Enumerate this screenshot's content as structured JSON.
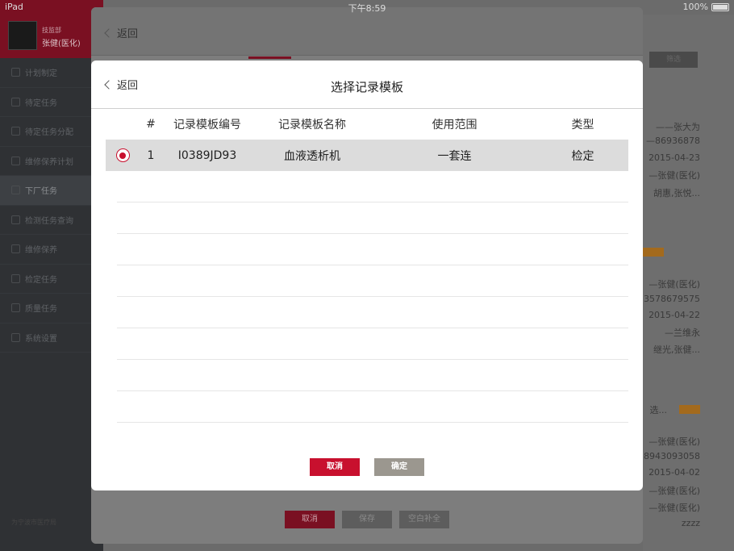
{
  "statusbar": {
    "device": "iPad",
    "time": "下午8:59",
    "battery": "100%"
  },
  "sidebar": {
    "role": "技监部",
    "name": "张健(医化)",
    "items": [
      {
        "label": "计划制定"
      },
      {
        "label": "待定任务"
      },
      {
        "label": "待定任务分配"
      },
      {
        "label": "维修保养计划"
      },
      {
        "label": "下厂任务",
        "active": true
      },
      {
        "label": "检测任务查询"
      },
      {
        "label": "维修保养"
      },
      {
        "label": "检定任务"
      },
      {
        "label": "质量任务"
      },
      {
        "label": "系统设置"
      }
    ],
    "footer": "为宁波市医疗局"
  },
  "background": {
    "top_button": "筛选",
    "lines": [
      "——张大为",
      "—86936878",
      "2015-04-23",
      "—张健(医化)",
      "胡惠,张悦...",
      "—张健(医化)",
      "13578679575",
      "2015-04-22",
      "—兰维永",
      "继光,张健...",
      "选...",
      "—张健(医化)",
      "18943093058",
      "2015-04-02",
      "—张健(医化)",
      "—张健(医化)",
      "zzzz"
    ]
  },
  "outer_sheet": {
    "back_label": "返回",
    "buttons": {
      "cancel": "取消",
      "save": "保存",
      "blank": "空白补全"
    }
  },
  "modal": {
    "back_label": "返回",
    "title": "选择记录模板",
    "columns": [
      "#",
      "记录模板编号",
      "记录模板名称",
      "使用范围",
      "类型"
    ],
    "rows": [
      {
        "index": "1",
        "code": "I0389JD93",
        "name": "血液透析机",
        "scope": "一套连",
        "type": "检定",
        "selected": true
      }
    ],
    "cancel_label": "取消",
    "confirm_label": "确定"
  }
}
